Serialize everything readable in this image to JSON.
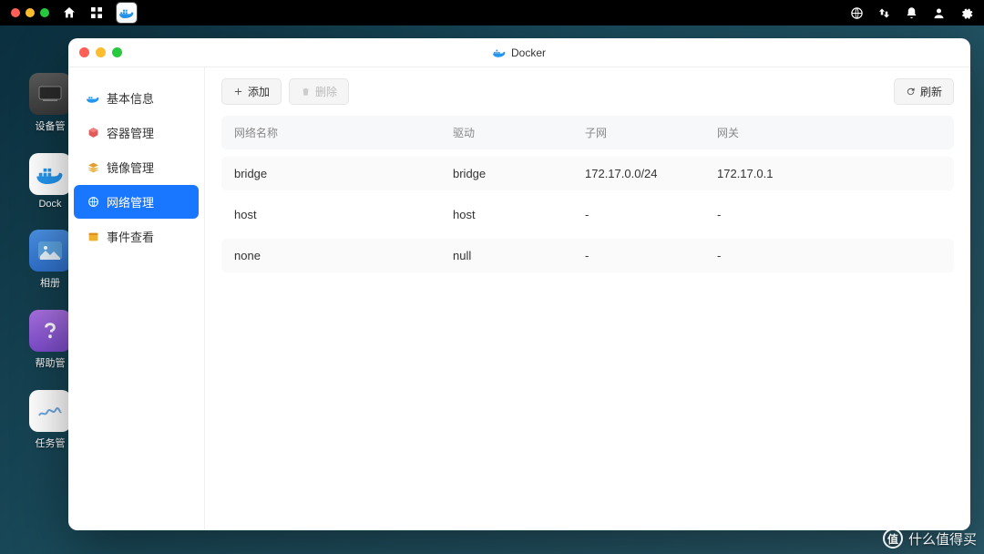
{
  "menubar": {},
  "dock": {
    "items": [
      {
        "label": "设备管"
      },
      {
        "label": "Dock"
      },
      {
        "label": "相册"
      },
      {
        "label": "帮助管"
      },
      {
        "label": "任务管"
      }
    ]
  },
  "window": {
    "title": "Docker",
    "sidebar": {
      "items": [
        {
          "label": "基本信息"
        },
        {
          "label": "容器管理"
        },
        {
          "label": "镜像管理"
        },
        {
          "label": "网络管理"
        },
        {
          "label": "事件查看"
        }
      ]
    },
    "toolbar": {
      "add": "添加",
      "delete": "删除",
      "refresh": "刷新"
    },
    "table": {
      "headers": {
        "name": "网络名称",
        "driver": "驱动",
        "subnet": "子网",
        "gateway": "网关"
      },
      "rows": [
        {
          "name": "bridge",
          "driver": "bridge",
          "subnet": "172.17.0.0/24",
          "gateway": "172.17.0.1"
        },
        {
          "name": "host",
          "driver": "host",
          "subnet": "-",
          "gateway": "-"
        },
        {
          "name": "none",
          "driver": "null",
          "subnet": "-",
          "gateway": "-"
        }
      ]
    }
  },
  "watermark": "什么值得买"
}
